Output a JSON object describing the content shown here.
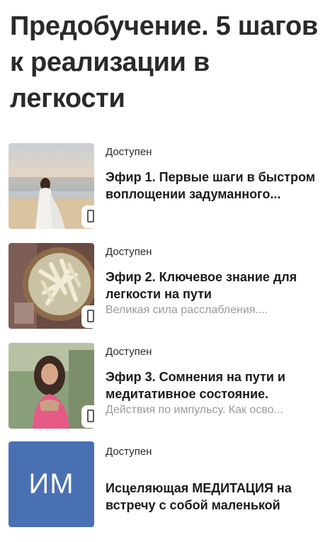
{
  "page": {
    "title": "Предобучение. 5 шагов к реализации в легкости"
  },
  "lessons": [
    {
      "status": "Доступен",
      "title": "Эфир 1. Первые шаги в быстром воплощении задуманного...",
      "subtitle": "",
      "icon": "mobile-device-icon"
    },
    {
      "status": "Доступен",
      "title": "Эфир 2. Ключевое знание для легкости на пути",
      "subtitle": "Великая сила расслабления....",
      "icon": "mobile-device-icon"
    },
    {
      "status": "Доступен",
      "title": "Эфир 3. Сомнения на пути и медитативное состояние.",
      "subtitle": "Действия по импульсу. Как осво...",
      "icon": "mobile-device-icon"
    },
    {
      "status": "Доступен",
      "title": "Исцеляющая МЕДИТАЦИЯ на встречу с собой маленькой",
      "subtitle": "",
      "initials": "ИМ",
      "thumb_color": "#4a70b4"
    }
  ]
}
